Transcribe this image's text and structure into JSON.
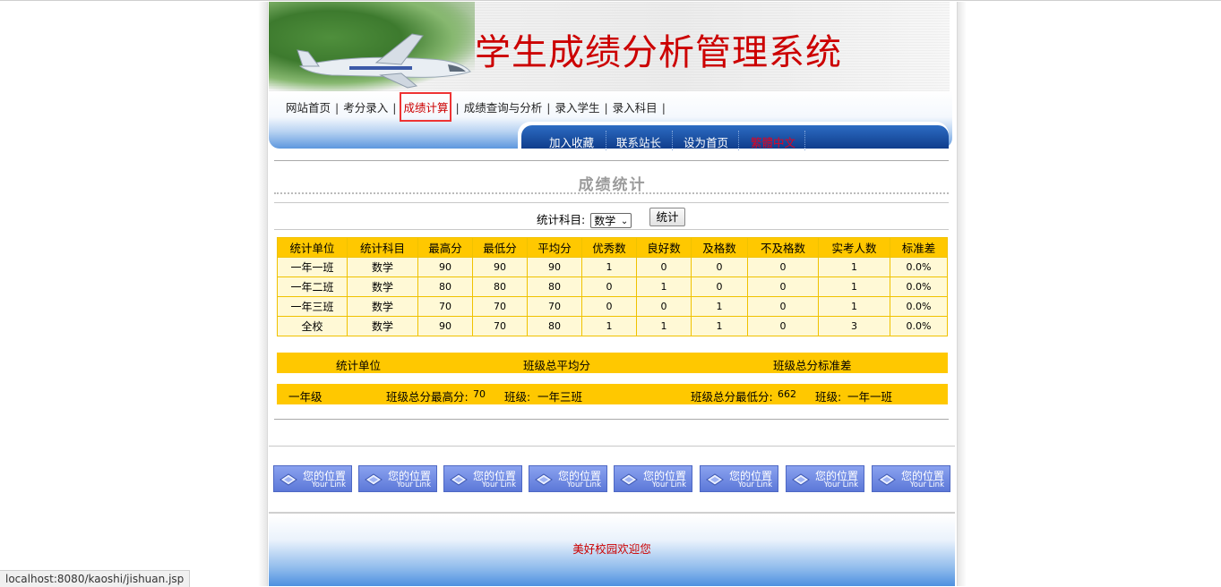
{
  "site_title": "学生成绩分析管理系统",
  "nav": {
    "items": [
      "网站首页",
      "考分录入",
      "成绩计算",
      "成绩查询与分析",
      "录入学生",
      "录入科目"
    ],
    "separator": "|",
    "sub_links": [
      "加入收藏",
      "联系站长",
      "设为首页",
      "繁體中文"
    ]
  },
  "section_title": "成绩统计",
  "filter": {
    "label": "统计科目:",
    "selected": "数学",
    "button": "统计"
  },
  "stats_table": {
    "headers": [
      "统计单位",
      "统计科目",
      "最高分",
      "最低分",
      "平均分",
      "优秀数",
      "良好数",
      "及格数",
      "不及格数",
      "实考人数",
      "标准差"
    ],
    "rows": [
      [
        "一年一班",
        "数学",
        "90",
        "90",
        "90",
        "1",
        "0",
        "0",
        "0",
        "1",
        "0.0%"
      ],
      [
        "一年二班",
        "数学",
        "80",
        "80",
        "80",
        "0",
        "1",
        "0",
        "0",
        "1",
        "0.0%"
      ],
      [
        "一年三班",
        "数学",
        "70",
        "70",
        "70",
        "0",
        "0",
        "1",
        "0",
        "1",
        "0.0%"
      ],
      [
        "全校",
        "数学",
        "90",
        "70",
        "80",
        "1",
        "1",
        "1",
        "0",
        "3",
        "0.0%"
      ]
    ]
  },
  "summary_header": {
    "unit": "统计单位",
    "avg": "班级总平均分",
    "std": "班级总分标准差"
  },
  "summary_row": {
    "grade": "一年级",
    "max_label": "班级总分最高分:",
    "max_value": "70",
    "max_class_label": "班级:",
    "max_class": "一年三班",
    "min_label": "班级总分最低分:",
    "min_value": "662",
    "min_class_label": "班级:",
    "min_class": "一年一班"
  },
  "link_buttons": [
    {
      "title": "您的位置",
      "sub": "Your Link"
    },
    {
      "title": "您的位置",
      "sub": "Your Link"
    },
    {
      "title": "您的位置",
      "sub": "Your Link"
    },
    {
      "title": "您的位置",
      "sub": "Your Link"
    },
    {
      "title": "您的位置",
      "sub": "Your Link"
    },
    {
      "title": "您的位置",
      "sub": "Your Link"
    },
    {
      "title": "您的位置",
      "sub": "Your Link"
    },
    {
      "title": "您的位置",
      "sub": "Your Link"
    }
  ],
  "footer_text": "美好校园欢迎您",
  "status_url": "localhost:8080/kaoshi/jishuan.jsp",
  "colors": {
    "accent_red": "#cc0000",
    "table_header": "#ffc800",
    "table_cell": "#fff9d6",
    "nav_blue": "#0f3d8c"
  }
}
